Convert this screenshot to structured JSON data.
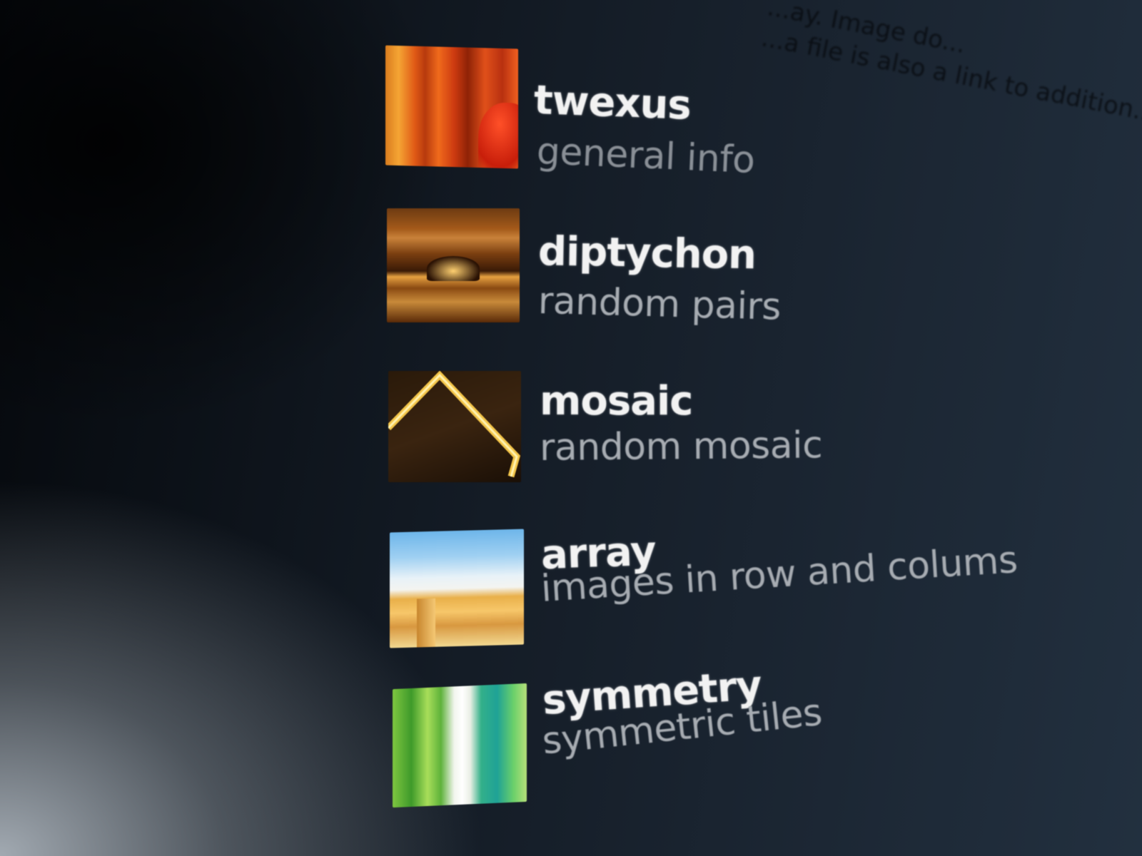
{
  "background_text": {
    "line1": "...a file is also a link to addition...",
    "line2": "...ay. Image do..."
  },
  "menu": {
    "items": [
      {
        "title": "twexus",
        "subtitle": "general info",
        "icon": "curtain-thumbnail"
      },
      {
        "title": "diptychon",
        "subtitle": "random pairs",
        "icon": "night-lights-thumbnail"
      },
      {
        "title": "mosaic",
        "subtitle": "random mosaic",
        "icon": "roof-outline-thumbnail"
      },
      {
        "title": "array",
        "subtitle": "images in row and colums",
        "icon": "sky-building-thumbnail"
      },
      {
        "title": "symmetry",
        "subtitle": "symmetric tiles",
        "icon": "green-stripes-thumbnail"
      }
    ]
  },
  "colors": {
    "background": "#0b0f14",
    "title": "#f2f2f2",
    "subtitle": "#a7acb2"
  }
}
